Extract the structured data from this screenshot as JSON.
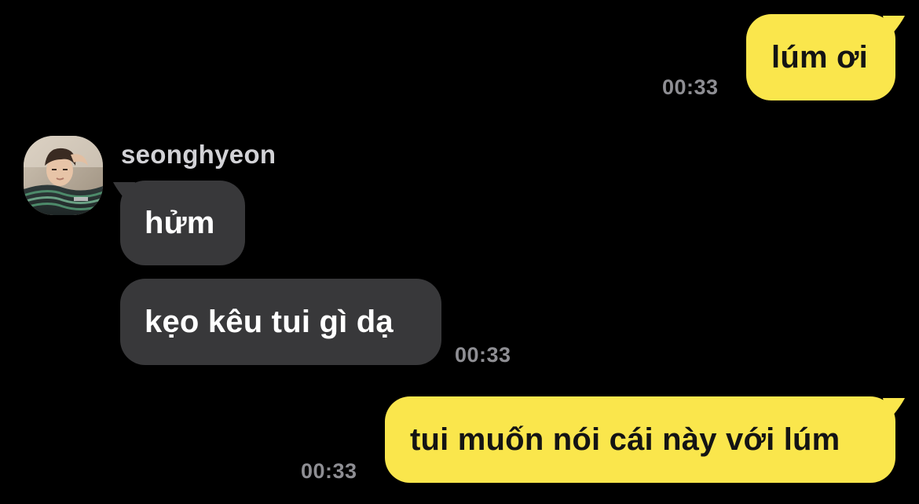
{
  "chat": {
    "contact": {
      "name": "seonghyeon",
      "avatar_icon": "profile-photo"
    },
    "colors": {
      "background": "#000000",
      "outgoing_bubble": "#FAE64C",
      "incoming_bubble": "#38383A",
      "timestamp": "#8E8E93"
    },
    "messages": [
      {
        "direction": "outgoing",
        "text": "lúm ơi",
        "time": "00:33"
      },
      {
        "direction": "incoming",
        "text": "hửm",
        "time": ""
      },
      {
        "direction": "incoming",
        "text": "kẹo kêu tui gì dạ",
        "time": "00:33"
      },
      {
        "direction": "outgoing",
        "text": "tui muốn nói cái này với lúm",
        "time": "00:33"
      }
    ]
  }
}
